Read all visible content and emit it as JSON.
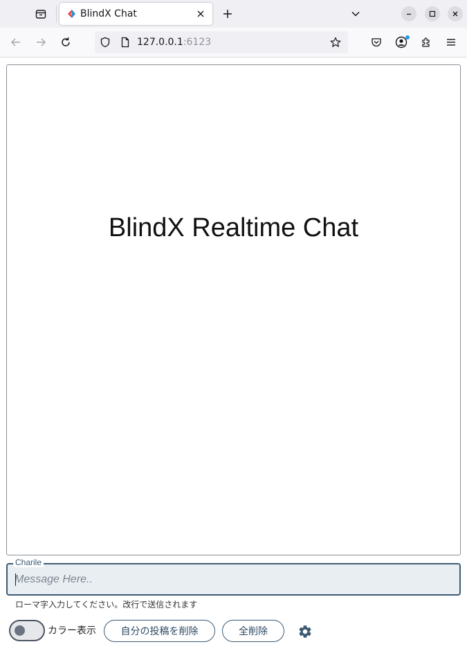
{
  "browser": {
    "tab_title": "BlindX Chat",
    "url_host": "127.0.0.1",
    "url_port": ":6123"
  },
  "chat": {
    "title": "BlindX Realtime Chat"
  },
  "composer": {
    "user_label": "Charile",
    "placeholder": "Message Here..",
    "hint": "ローマ字入力してください。改行で送信されます"
  },
  "controls": {
    "color_toggle_label": "カラー表示",
    "color_toggle_on": false,
    "delete_own_label": "自分の投稿を削除",
    "delete_all_label": "全削除"
  },
  "colors": {
    "accent": "#3c5a74",
    "input_bg": "#e9eef3",
    "badge": "#1e9be8"
  }
}
